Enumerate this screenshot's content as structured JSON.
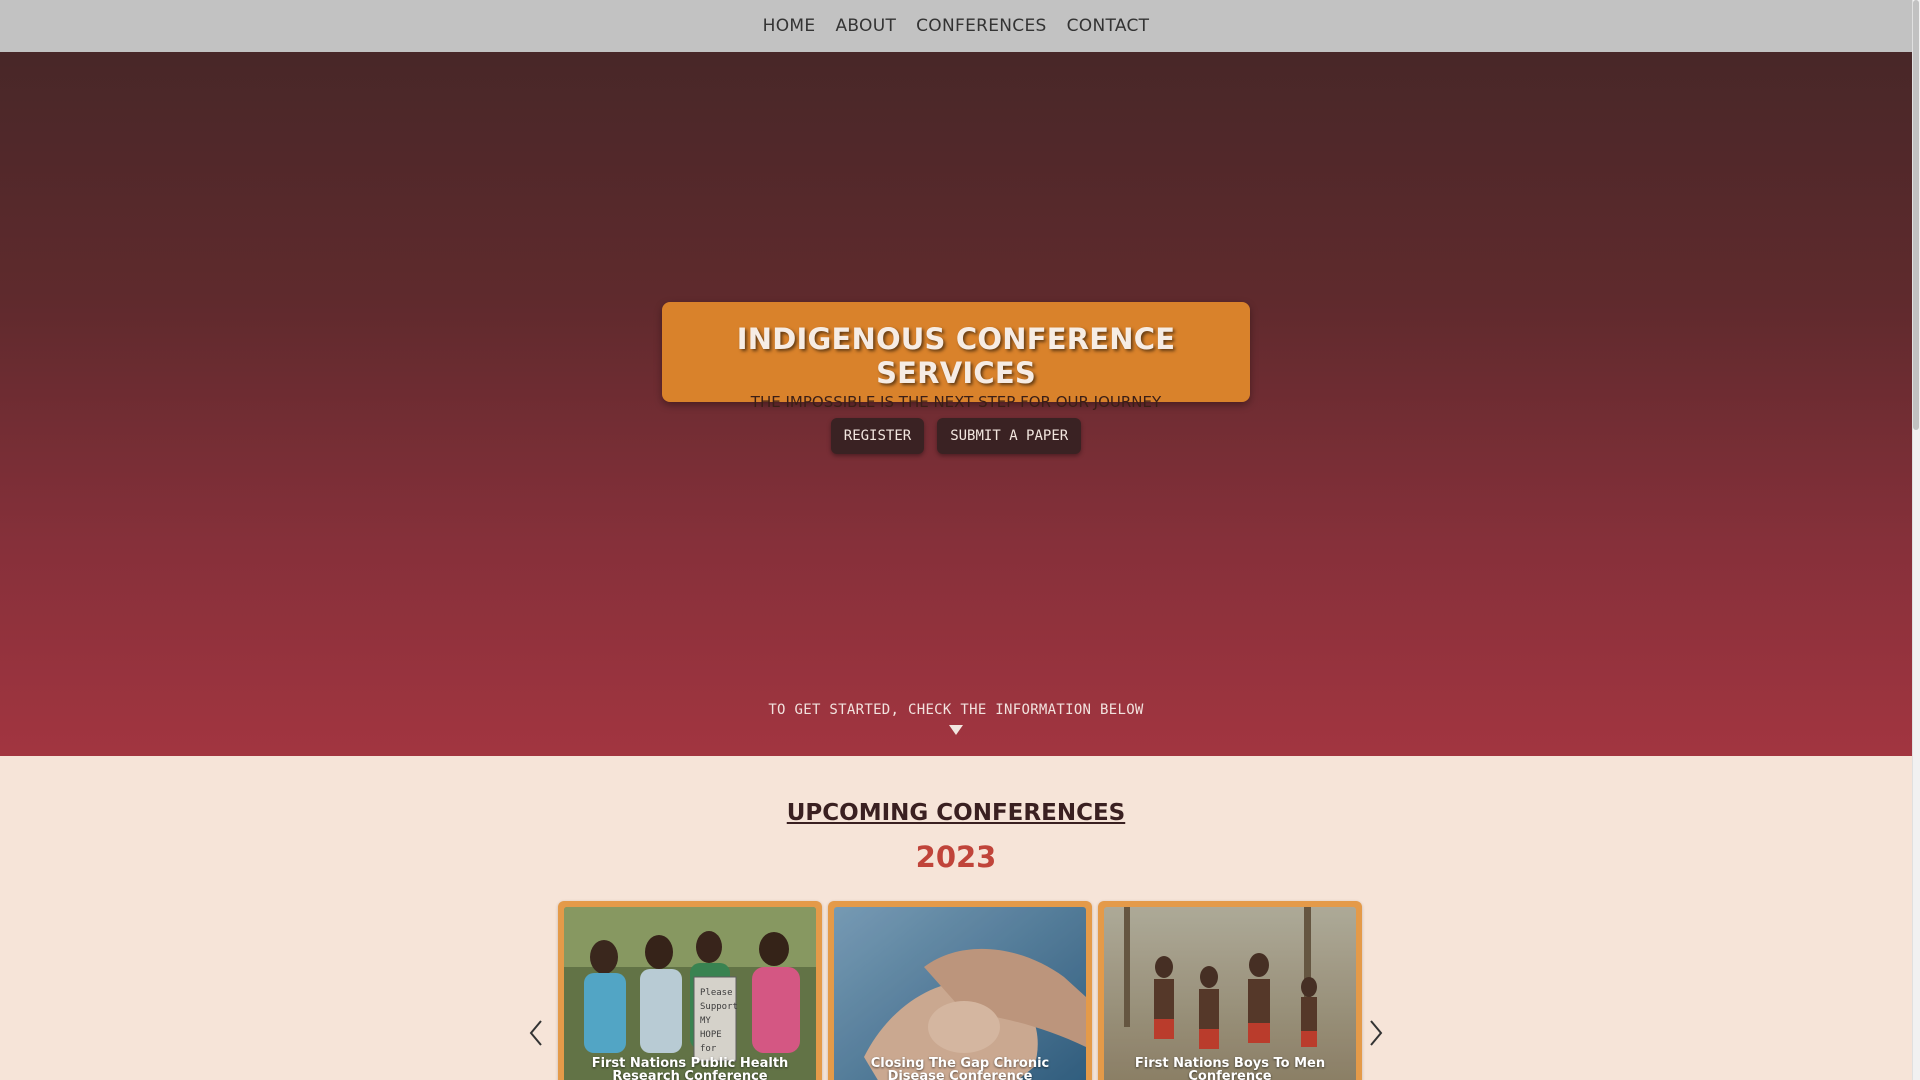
{
  "nav": {
    "items": [
      {
        "label": "HOME"
      },
      {
        "label": "ABOUT"
      },
      {
        "label": "CONFERENCES"
      },
      {
        "label": "CONTACT"
      }
    ]
  },
  "hero": {
    "title": "INDIGENOUS CONFERENCE SERVICES",
    "subtitle": "THE IMPOSSIBLE IS THE NEXT STEP FOR OUR JOURNEY",
    "register_label": "REGISTER",
    "submit_paper_label": "SUBMIT A PAPER",
    "cta_text": "TO GET STARTED, CHECK THE INFORMATION BELOW"
  },
  "upcoming": {
    "title": "UPCOMING CONFERENCES",
    "year": "2023",
    "cards": [
      {
        "title": "First Nations Public Health Research Conference",
        "image": "group-of-women-photo"
      },
      {
        "title": "Closing The Gap Chronic Disease Conference",
        "image": "holding-hands-photo"
      },
      {
        "title": "First Nations Boys To Men Conference",
        "image": "dancers-photo"
      }
    ]
  },
  "colors": {
    "nav_bg": "#c2c2c2",
    "hero_top": "#482728",
    "hero_bottom": "#a23540",
    "accent_orange": "#d9822b",
    "year_red": "#c0443a",
    "section_bg": "#f6e4d8"
  },
  "icons": {
    "prev": "chevron-left-icon",
    "next": "chevron-right-icon",
    "down": "triangle-down-icon"
  }
}
